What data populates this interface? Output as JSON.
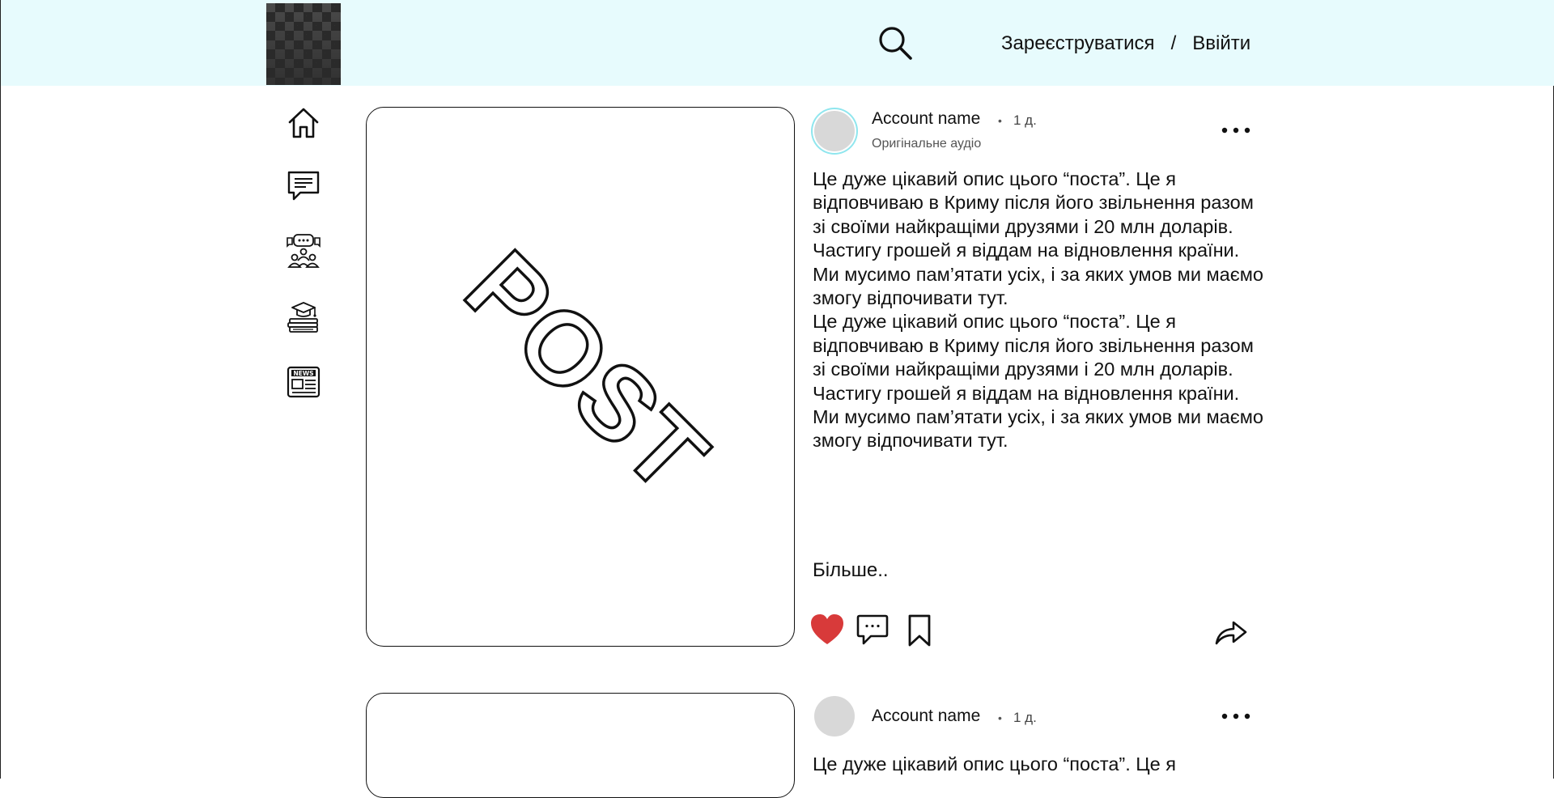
{
  "header": {
    "register_label": "Зареєструватися",
    "separator": "/",
    "login_label": "Ввійти",
    "icons": [
      "logo",
      "search-icon"
    ]
  },
  "sidebar": {
    "items": [
      {
        "name": "home",
        "icon": "home-icon"
      },
      {
        "name": "messages",
        "icon": "chat-icon"
      },
      {
        "name": "communities",
        "icon": "group-chat-icon"
      },
      {
        "name": "education",
        "icon": "graduation-books-icon"
      },
      {
        "name": "news",
        "icon": "newspaper-icon"
      }
    ]
  },
  "posts": [
    {
      "image_text": "POST",
      "account_name": "Account name",
      "dot": "•",
      "time": "1 д.",
      "audio": "Оригінальне аудіо",
      "description": [
        "Це дуже цікавий опис цього “поста”. Це я відповчиваю в Криму після його звільнення разом зі своїми найкращіми друзями і 20 млн доларів.",
        "Частигу грошей я віддам на відновлення країни.",
        "Ми мусимо пам’ятати усіх, і за яких умов ми маємо змогу відпочивати тут.",
        "Це дуже цікавий опис цього “поста”. Це я відповчиваю в Криму після його звільнення разом зі своїми найкращіми друзями і 20 млн доларів.",
        "Частигу грошей я віддам на відновлення країни.",
        "Ми мусимо пам’ятати усіх, і за яких умов ми маємо змогу відпочивати тут."
      ],
      "more_label": "Більше..",
      "liked": true,
      "like_color": "#d83a3a"
    },
    {
      "account_name": "Account name",
      "dot": "•",
      "time": "1 д.",
      "description": [
        "Це дуже цікавий опис цього “поста”. Це я"
      ]
    }
  ],
  "colors": {
    "header_bg": "#e7fbfd",
    "story_ring": "#8fe6ee",
    "like": "#d83a3a"
  }
}
